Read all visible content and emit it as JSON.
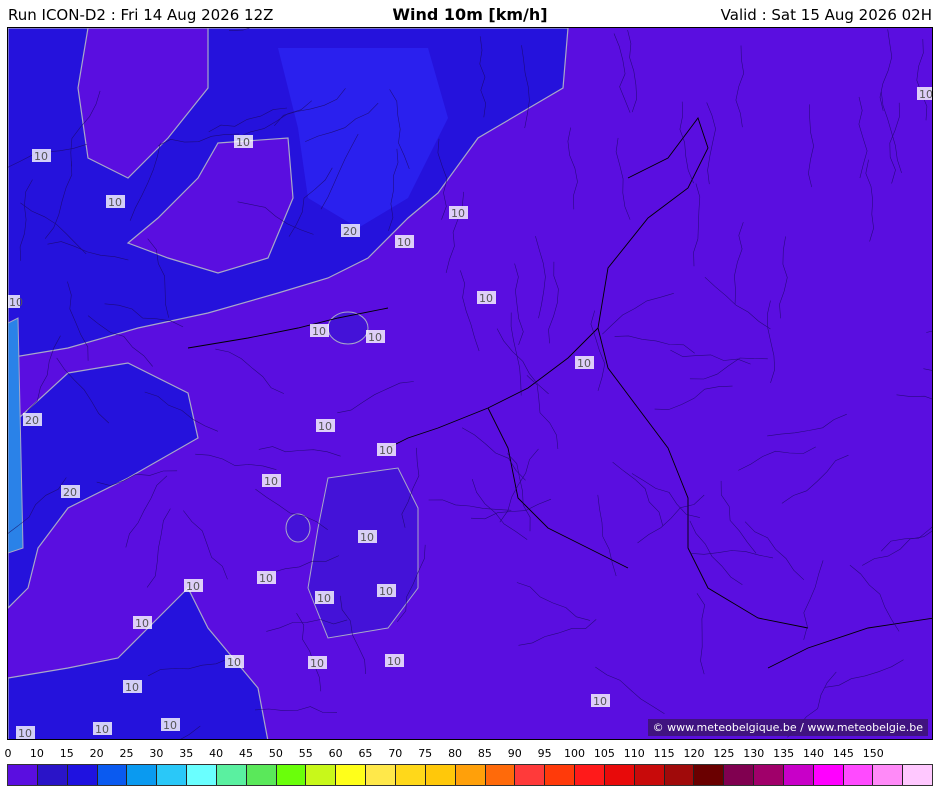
{
  "header": {
    "run": "Run ICON-D2 : Fri 14 Aug 2026 12Z",
    "title": "Wind 10m [km/h]",
    "valid": "Valid : Sat 15 Aug 2026 02H"
  },
  "map": {
    "credit": "© www.meteobelgique.be / www.meteobelgie.be",
    "contour_labels": [
      "10",
      "10",
      "10",
      "20",
      "10",
      "10",
      "10",
      "10",
      "10",
      "10",
      "20",
      "10",
      "10",
      "10",
      "20",
      "10",
      "10",
      "10",
      "10",
      "10",
      "10",
      "10",
      "10",
      "10",
      "10",
      "10",
      "10",
      "10",
      "10",
      "10",
      "10",
      "10"
    ],
    "colors": {
      "ocean_weak": "#1f12d8",
      "ocean_mid": "#2f1fe8",
      "land": "#5a0ee0",
      "coast_light": "#2a82e8"
    }
  },
  "scale": {
    "ticks": [
      "0",
      "10",
      "15",
      "20",
      "25",
      "30",
      "35",
      "40",
      "45",
      "50",
      "55",
      "60",
      "65",
      "70",
      "75",
      "80",
      "85",
      "90",
      "95",
      "100",
      "105",
      "110",
      "115",
      "120",
      "125",
      "130",
      "135",
      "140",
      "145",
      "150"
    ],
    "colors": [
      "#5a0ee0",
      "#2a14c8",
      "#1f12e0",
      "#0a5af0",
      "#0a9af0",
      "#2ac8f8",
      "#6affff",
      "#5af0a0",
      "#5ae85a",
      "#6aff0a",
      "#c8f81a",
      "#ffff1a",
      "#ffe84a",
      "#ffd81a",
      "#ffc80a",
      "#ffa00a",
      "#ff6a0a",
      "#ff3a3a",
      "#ff3a0a",
      "#ff1a1a",
      "#e80a0a",
      "#c80a0a",
      "#a00a0a",
      "#6a0000",
      "#800050",
      "#a0006a",
      "#c800c8",
      "#ff00ff",
      "#ff4aff",
      "#ff8af8",
      "#ffc8ff"
    ]
  }
}
